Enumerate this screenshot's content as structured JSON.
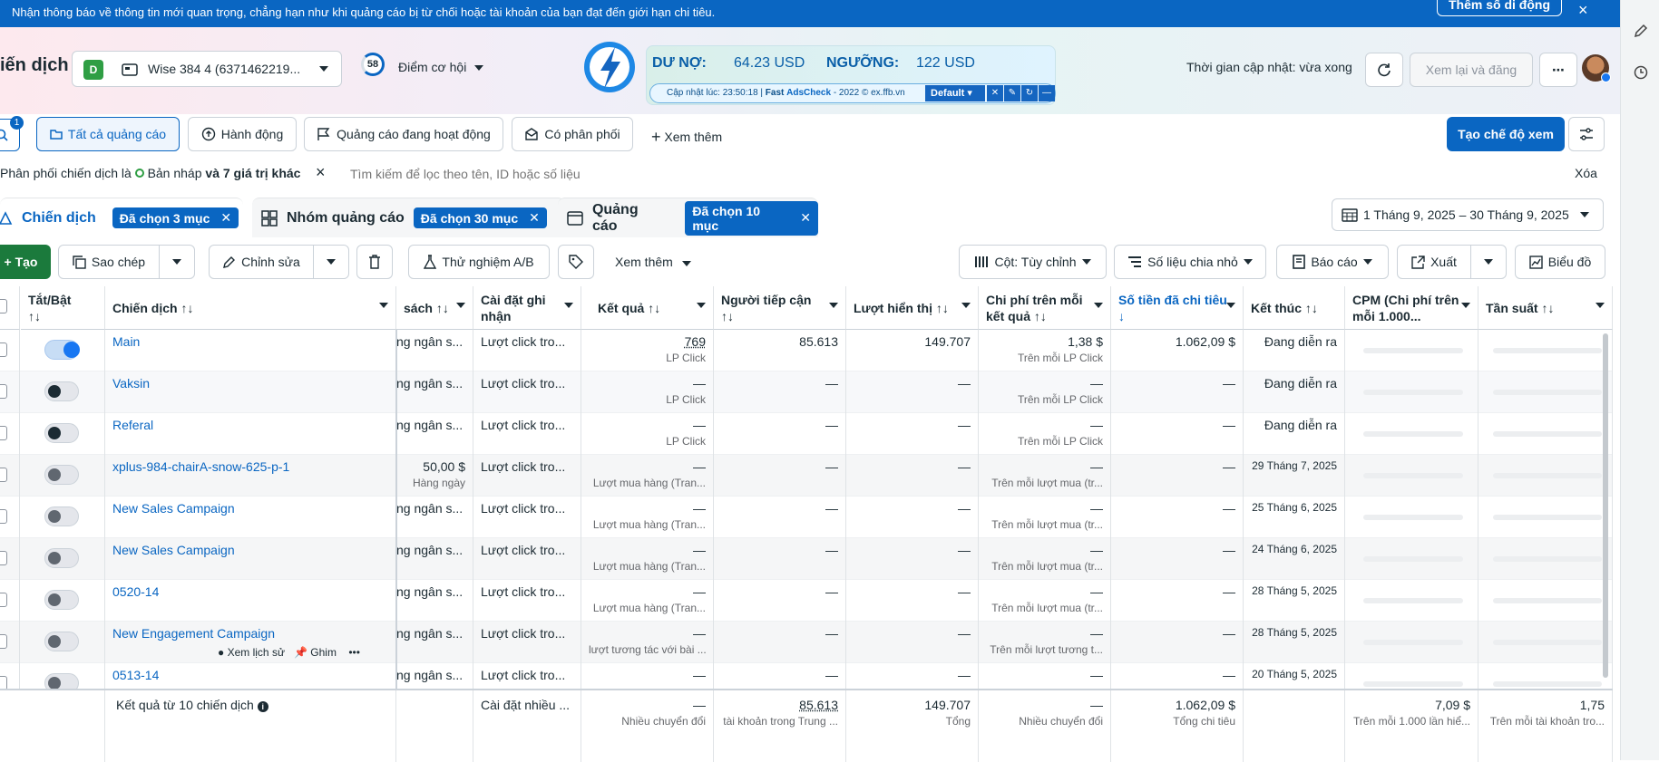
{
  "notice": {
    "text": "Nhận thông báo về thông tin mới quan trọng, chẳng hạn như khi quảng cáo bị từ chối hoặc tài khoản của bạn đạt đến giới hạn chi tiêu.",
    "button": "Thêm số di động",
    "close": "×"
  },
  "header": {
    "title": "iến dịch",
    "account_badge": "D",
    "account_name": "Wise 384 4 (6371462219...",
    "opportunity_score": "58",
    "opportunity_label": "Điểm cơ hội",
    "update_status": "Thời gian cập nhật: vừa xong",
    "review_button": "Xem lại và đăng",
    "more": "⋯"
  },
  "widget": {
    "debt_label": "DƯ NỢ:",
    "debt_value": "64.23 USD",
    "threshold_label": "NGƯỠNG:",
    "threshold_value": "122 USD",
    "update_prefix": "Cập nhật lúc: 23:50:18 | ",
    "brand": "Fast",
    "brand2": "AdsCheck",
    "suffix": " - 2022 © ex.ffb.vn",
    "mode": "Default"
  },
  "filters": {
    "search_badge": "1",
    "all_ads": "Tất cả quảng cáo",
    "actions": "Hành động",
    "active_ads": "Quảng cáo đang hoạt động",
    "distributed": "Có phân phối",
    "see_more": "Xem thêm",
    "create_view": "Tạo chế độ xem"
  },
  "filterbar": {
    "prefix": "Phân phối chiến dịch là ",
    "status": "Bản nháp",
    "suffix": " và 7 giá trị khác",
    "placeholder": "Tìm kiếm để lọc theo tên, ID hoặc số liệu",
    "clear": "Xóa"
  },
  "tabs": {
    "campaigns": "Chiến dịch",
    "campaigns_chip": "Đã chọn 3 mục",
    "adsets": "Nhóm quảng cáo",
    "adsets_chip": "Đã chọn 30 mục",
    "ads": "Quảng cáo",
    "ads_chip": "Đã chọn 10 mục",
    "date_range": "1 Tháng 9, 2025 – 30 Tháng 9, 2025"
  },
  "toolbar": {
    "create": "Tạo",
    "copy": "Sao chép",
    "edit": "Chỉnh sửa",
    "ab_test": "Thử nghiệm A/B",
    "see_more": "Xem thêm",
    "columns": "Cột: Tùy chỉnh",
    "breakdown": "Số liệu chia nhỏ",
    "reports": "Báo cáo",
    "export": "Xuất",
    "chart": "Biểu đồ"
  },
  "columns": {
    "toggle": "Tắt/Bật",
    "campaign": "Chiến dịch",
    "budget": "sách",
    "attribution": "Cài đặt ghi nhận",
    "results": "Kết quả",
    "reach": "Người tiếp cận",
    "impressions": "Lượt hiển thị",
    "cpr": "Chi phí trên mỗi kết quả",
    "spent": "Số tiền đã chi tiêu",
    "end": "Kết thúc",
    "cpm": "CPM (Chi phí trên mỗi 1.000...",
    "frequency": "Tần suất"
  },
  "rows": [
    {
      "name": "Main",
      "toggle": "on",
      "budget": "ng ngân s...",
      "budget_sub": "",
      "attr": "Lượt click tro...",
      "result": "769",
      "result_sub": "LP Click",
      "reach": "85.613",
      "impr": "149.707",
      "cpr": "1,38 $",
      "cpr_sub": "Trên mỗi LP Click",
      "spent": "1.062,09 $",
      "end": "Đang diễn ra"
    },
    {
      "name": "Vaksin",
      "toggle": "dark",
      "budget": "ng ngân s...",
      "budget_sub": "",
      "attr": "Lượt click tro...",
      "result": "—",
      "result_sub": "LP Click",
      "reach": "—",
      "impr": "—",
      "cpr": "—",
      "cpr_sub": "Trên mỗi LP Click",
      "spent": "—",
      "end": "Đang diễn ra"
    },
    {
      "name": "Referal",
      "toggle": "dark",
      "budget": "ng ngân s...",
      "budget_sub": "",
      "attr": "Lượt click tro...",
      "result": "—",
      "result_sub": "LP Click",
      "reach": "—",
      "impr": "—",
      "cpr": "—",
      "cpr_sub": "Trên mỗi LP Click",
      "spent": "—",
      "end": "Đang diễn ra"
    },
    {
      "name": "xplus-984-chairA-snow-625-p-1",
      "toggle": "gray",
      "budget": "50,00 $",
      "budget_sub": "Hàng ngày",
      "attr": "Lượt click tro...",
      "result": "—",
      "result_sub": "Lượt mua hàng (Tran...",
      "reach": "—",
      "impr": "—",
      "cpr": "—",
      "cpr_sub": "Trên mỗi lượt mua (tr...",
      "spent": "—",
      "end": "29 Tháng 7, 2025"
    },
    {
      "name": "New Sales Campaign",
      "toggle": "gray",
      "budget": "ng ngân s...",
      "budget_sub": "",
      "attr": "Lượt click tro...",
      "result": "—",
      "result_sub": "Lượt mua hàng (Tran...",
      "reach": "—",
      "impr": "—",
      "cpr": "—",
      "cpr_sub": "Trên mỗi lượt mua (tr...",
      "spent": "—",
      "end": "25 Tháng 6, 2025"
    },
    {
      "name": "New Sales Campaign",
      "toggle": "gray",
      "budget": "ng ngân s...",
      "budget_sub": "",
      "attr": "Lượt click tro...",
      "result": "—",
      "result_sub": "Lượt mua hàng (Tran...",
      "reach": "—",
      "impr": "—",
      "cpr": "—",
      "cpr_sub": "Trên mỗi lượt mua (tr...",
      "spent": "—",
      "end": "24 Tháng 6, 2025"
    },
    {
      "name": "0520-14",
      "toggle": "gray",
      "budget": "ng ngân s...",
      "budget_sub": "",
      "attr": "Lượt click tro...",
      "result": "—",
      "result_sub": "Lượt mua hàng (Tran...",
      "reach": "—",
      "impr": "—",
      "cpr": "—",
      "cpr_sub": "Trên mỗi lượt mua (tr...",
      "spent": "—",
      "end": "28 Tháng 5, 2025"
    },
    {
      "name": "New Engagement Campaign",
      "toggle": "gray",
      "budget": "ng ngân s...",
      "budget_sub": "",
      "attr": "Lượt click tro...",
      "result": "—",
      "result_sub": "lượt tương tác với bài ...",
      "reach": "—",
      "impr": "—",
      "cpr": "—",
      "cpr_sub": "Trên mỗi lượt tương t...",
      "spent": "—",
      "end": "28 Tháng 5, 2025",
      "history": "Xem lịch sử",
      "pin": "Ghim",
      "more": "•••"
    },
    {
      "name": "0513-14",
      "toggle": "gray",
      "budget": "ng ngân s...",
      "budget_sub": "",
      "attr": "Lượt click tro...",
      "result": "—",
      "result_sub": "",
      "reach": "—",
      "impr": "—",
      "cpr": "—",
      "cpr_sub": "",
      "spent": "—",
      "end": "20 Tháng 5, 2025"
    }
  ],
  "footer": {
    "label": "Kết quả từ 10 chiến dịch",
    "attr": "Cài đặt nhiều ...",
    "result": "—",
    "result_sub": "Nhiều chuyển đổi",
    "reach": "85.613",
    "reach_sub": "tài khoản trong Trung ...",
    "impr": "149.707",
    "impr_sub": "Tổng",
    "cpr": "—",
    "cpr_sub": "Nhiều chuyển đổi",
    "spent": "1.062,09 $",
    "spent_sub": "Tổng chi tiêu",
    "cpm": "7,09 $",
    "cpm_sub": "Trên mỗi 1.000 lần hiể...",
    "freq": "1,75",
    "freq_sub": "Trên mỗi tài khoản tro..."
  },
  "colors": {
    "primary": "#0a66c2",
    "notice_bg": "#0a66c2"
  }
}
